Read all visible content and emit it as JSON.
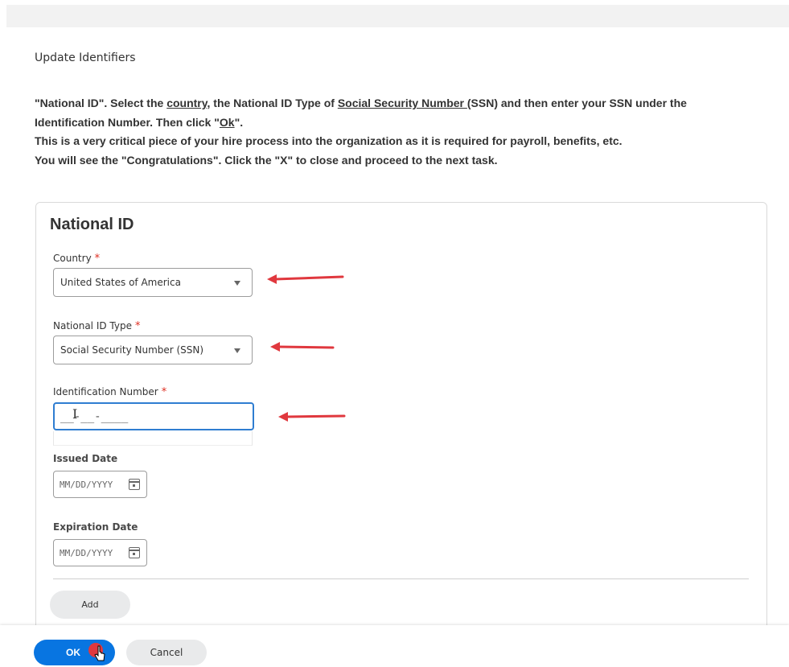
{
  "header": {
    "title": "Update Identifiers"
  },
  "instructions": {
    "line1_a": "\"National ID\". Select the ",
    "line1_link1": "country",
    "line1_b": ", the National ID Type of ",
    "line1_link2": "Social Security Number ",
    "line1_c": "(SSN) and then enter your SSN under the",
    "line2_a": "Identification Number. Then click \"",
    "line2_link": "Ok",
    "line2_b": "\".",
    "line3": "This is a very critical piece of your hire process into the organization as it is required for payroll, benefits, etc.",
    "line4": "You will see the \"Congratulations\". Click the \"X\" to close and proceed to the next task."
  },
  "card": {
    "title": "National ID",
    "required_mark": "*",
    "country": {
      "label": "Country",
      "value": "United States of America"
    },
    "id_type": {
      "label": "National ID Type",
      "value": "Social Security Number (SSN)"
    },
    "id_number": {
      "label": "Identification Number",
      "value": "__-__-____"
    },
    "issued_date": {
      "label": "Issued Date",
      "placeholder": "MM/DD/YYYY"
    },
    "expiration_date": {
      "label": "Expiration Date",
      "placeholder": "MM/DD/YYYY"
    },
    "add_label": "Add"
  },
  "footer": {
    "ok_label": "OK",
    "cancel_label": "Cancel"
  },
  "colors": {
    "primary": "#0875e1",
    "required": "#de2e21",
    "annotation_arrow": "#e0383e",
    "focus_border": "#2f7dd1"
  }
}
